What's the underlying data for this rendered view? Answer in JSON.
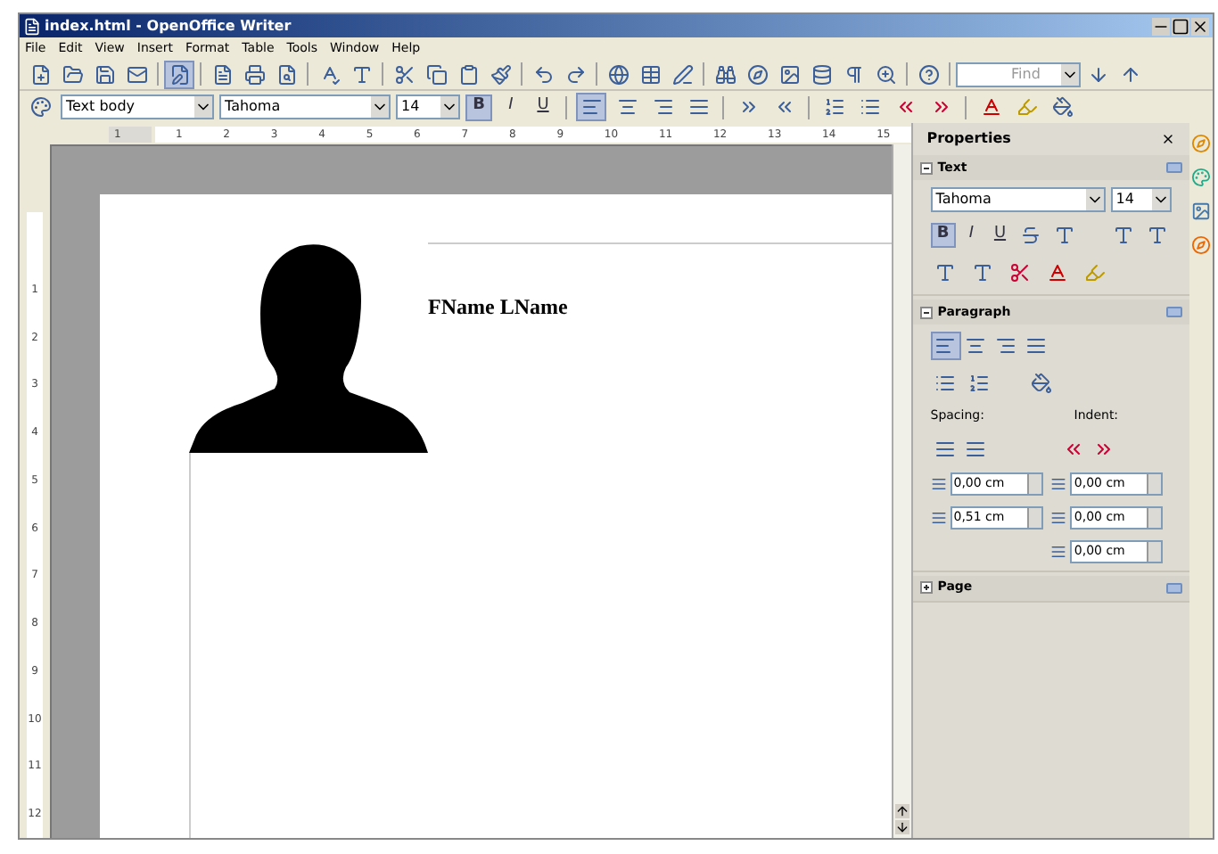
{
  "window": {
    "title": "index.html - OpenOffice Writer"
  },
  "menu": [
    "File",
    "Edit",
    "View",
    "Insert",
    "Format",
    "Table",
    "Tools",
    "Window",
    "Help"
  ],
  "standard_toolbar": {
    "edit_mode_on": true,
    "find": {
      "placeholder": "Find"
    }
  },
  "formatting_toolbar": {
    "style": "Text body",
    "font": "Tahoma",
    "size": "14",
    "buttons": [
      {
        "label": "B",
        "selected": true
      },
      {
        "label": "I",
        "selected": false
      },
      {
        "label": "U",
        "selected": false
      }
    ],
    "align": [
      {
        "selected": true
      },
      {
        "selected": false
      },
      {
        "selected": false
      },
      {
        "selected": false
      }
    ]
  },
  "ruler": {
    "labels": [
      "1",
      "1",
      "2",
      "3",
      "4",
      "5",
      "6",
      "7",
      "8",
      "9",
      "10",
      "11",
      "12",
      "13",
      "14",
      "15"
    ]
  },
  "vertical_ruler": {
    "labels": [
      "1",
      "2",
      "3",
      "4",
      "5",
      "6",
      "7",
      "8",
      "9",
      "10",
      "11",
      "12"
    ]
  },
  "document": {
    "heading": "FName LName"
  },
  "sidebar": {
    "title": "Properties",
    "text_section": {
      "title": "Text",
      "expanded": true,
      "font": "Tahoma",
      "size": "14",
      "buttons": [
        {
          "label": "B",
          "selected": true
        },
        {
          "label": "I",
          "selected": false
        },
        {
          "label": "U",
          "selected": false
        }
      ]
    },
    "paragraph_section": {
      "title": "Paragraph",
      "expanded": true,
      "spacing_label": "Spacing:",
      "indent_label": "Indent:",
      "fields": [
        {
          "value": "0,00 cm"
        },
        {
          "value": "0,00 cm"
        },
        {
          "value": "0,51 cm"
        },
        {
          "value": "0,00 cm"
        },
        {
          "value": "0,00 cm"
        }
      ]
    },
    "page_section": {
      "title": "Page",
      "expanded": false
    }
  }
}
